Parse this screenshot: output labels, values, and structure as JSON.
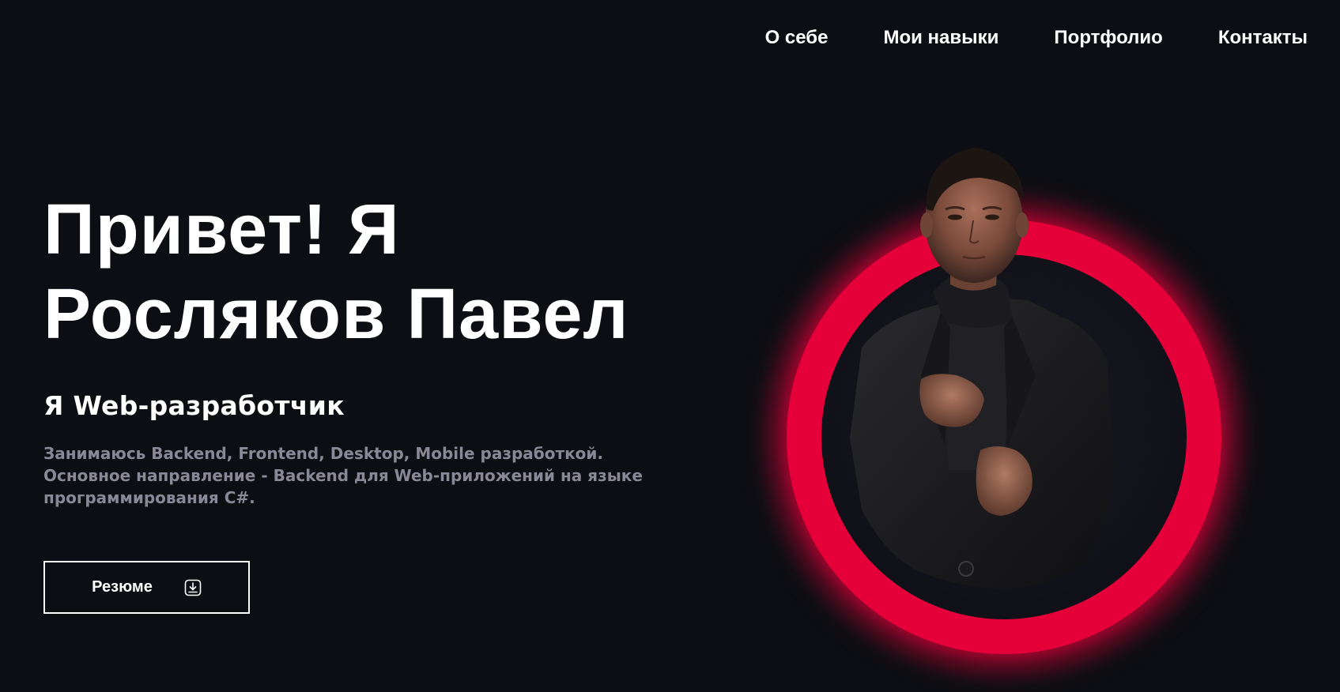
{
  "nav": {
    "items": [
      {
        "label": "О себе"
      },
      {
        "label": "Мои навыки"
      },
      {
        "label": "Портфолио"
      },
      {
        "label": "Контакты"
      }
    ]
  },
  "hero": {
    "title_line1": "Привет! Я",
    "title_line2": "Росляков Павел",
    "subtitle": "Я Web-разработчик",
    "desc_line1": "Занимаюсь Backend, Frontend, Desktop, Mobile разработкой.",
    "desc_line2": "Основное направление - Backend для Web-приложений на языке",
    "desc_line3": "программирования C#."
  },
  "resume_button": {
    "label": "Резюме",
    "icon": "download-icon"
  },
  "colors": {
    "background": "#0d0e13",
    "accent": "#e6003a",
    "text": "#ffffff",
    "muted_text": "#8a8896"
  }
}
